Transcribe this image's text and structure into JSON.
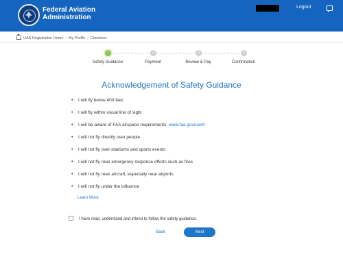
{
  "header": {
    "org_line1": "Federal Aviation",
    "org_line2": "Administration",
    "logout_label": "Logout",
    "bg_color": "#1565c0"
  },
  "breadcrumb": [
    "UAS Registration Home",
    "My Profile",
    "Checkout"
  ],
  "steps": [
    {
      "number": "1",
      "label": "Safety Guidance",
      "active": true
    },
    {
      "number": "2",
      "label": "Payment",
      "active": false
    },
    {
      "number": "3",
      "label": "Review & Pay",
      "active": false
    },
    {
      "number": "4",
      "label": "Confirmation",
      "active": false
    }
  ],
  "page_title": "Acknowledgement of Safety Guidance",
  "guidance": [
    "I will fly below 400 feet",
    "I will fly within visual line of sight",
    "I will be aware of FAA airspace requirements: ",
    "I will not fly directly over people",
    "I will not fly over stadiums and sports events",
    "I will not fly near emergency response efforts such as fires",
    "I will not fly near aircraft, especially near airports",
    "I will not fly under the influence"
  ],
  "airspace_link": "www.faa.gov/uasfr",
  "learn_more": "Learn More",
  "acknowledge_text": "I have read, understand and intend to follow the safety guidance.",
  "buttons": {
    "back": "Back",
    "next": "Next"
  },
  "icons": [
    "faa-seal-icon",
    "chat-icon",
    "home-icon"
  ],
  "colors": {
    "accent": "#1e76c8",
    "active_step": "#8bc34a",
    "inactive_step": "#cfcfcf"
  }
}
